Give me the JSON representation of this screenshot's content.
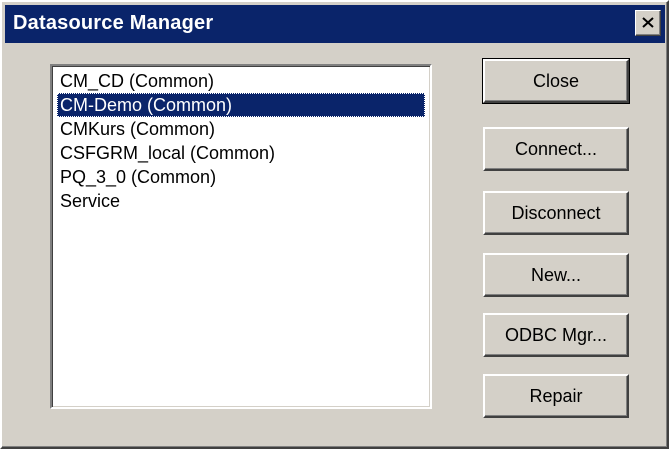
{
  "window": {
    "title": "Datasource Manager"
  },
  "titlebar": {
    "close_icon": "close-icon"
  },
  "datasources": {
    "items": [
      {
        "label": "CM_CD (Common)",
        "selected": false
      },
      {
        "label": "CM-Demo (Common)",
        "selected": true
      },
      {
        "label": "CMKurs (Common)",
        "selected": false
      },
      {
        "label": "CSFGRM_local (Common)",
        "selected": false
      },
      {
        "label": "PQ_3_0 (Common)",
        "selected": false
      },
      {
        "label": "Service",
        "selected": false
      }
    ]
  },
  "buttons": {
    "close": "Close",
    "connect": "Connect...",
    "disconnect": "Disconnect",
    "new": "New...",
    "odbc_mgr": "ODBC Mgr...",
    "repair": "Repair"
  },
  "colors": {
    "titlebar": "#0a246a",
    "face": "#d4d0c8",
    "selection": "#0a246a"
  }
}
